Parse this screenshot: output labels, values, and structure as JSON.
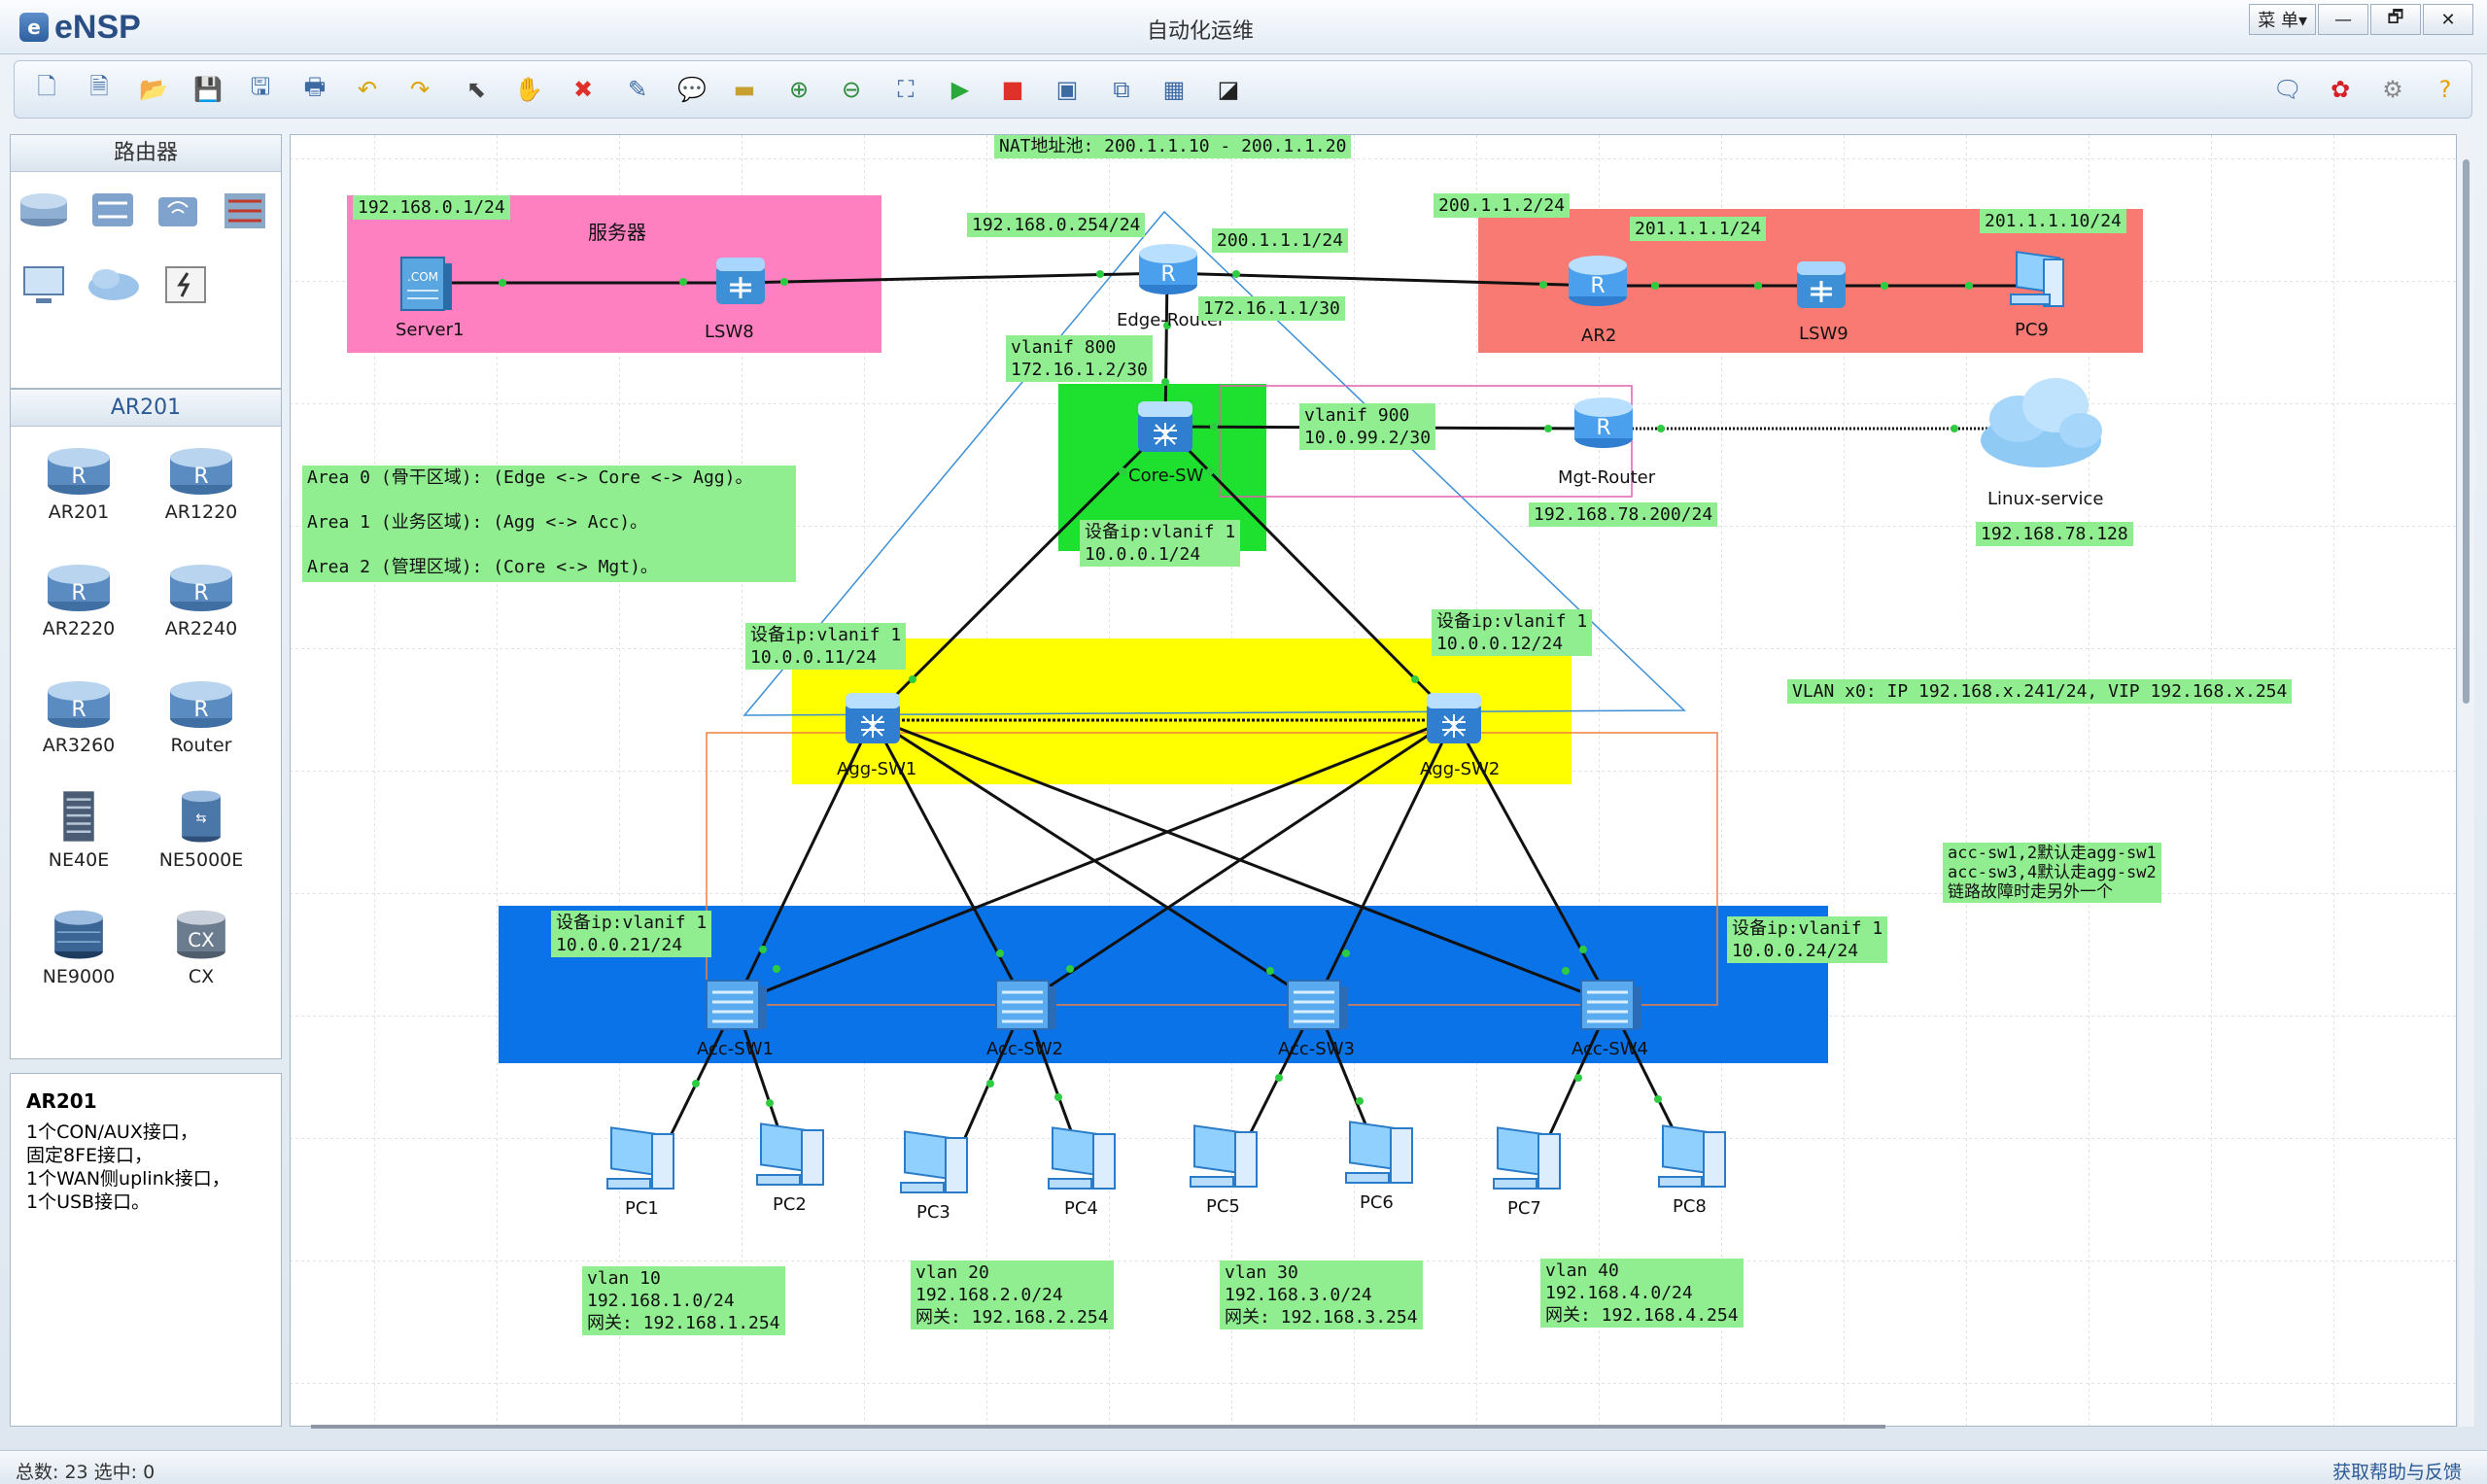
{
  "app": {
    "logo_mark": "e",
    "name": "eNSP",
    "window_title": "自动化运维",
    "menu_label": "菜 单▾",
    "minimize": "—",
    "restore": "🗗",
    "close": "✕"
  },
  "toolbar": {
    "left_icons": [
      "new-topology-icon",
      "new-lab-icon",
      "open-icon",
      "save-icon",
      "save-as-icon",
      "print-icon",
      "undo-icon",
      "redo-icon",
      "select-icon",
      "pan-hand-icon",
      "delete-icon",
      "delete-all-links-icon",
      "text-note-icon",
      "rectangle-icon",
      "zoom-in-icon",
      "zoom-out-icon",
      "fit-icon",
      "start-device-icon",
      "stop-device-icon",
      "capture-icon",
      "topology-icon",
      "grid-icon",
      "terminal-icon"
    ],
    "right_icons": [
      "chat-icon",
      "huawei-icon",
      "settings-icon",
      "help-icon"
    ]
  },
  "device_panel": {
    "title": "路由器",
    "category_icons": [
      "router-category-icon",
      "switch-category-icon",
      "wireless-category-icon",
      "firewall-category-icon",
      "pc-category-icon",
      "cloud-category-icon",
      "power-category-icon"
    ],
    "sub_title": "AR201",
    "models": [
      "AR201",
      "AR1220",
      "AR2220",
      "AR2240",
      "AR3260",
      "Router",
      "NE40E",
      "NE5000E",
      "NE9000",
      "CX"
    ]
  },
  "info_panel": {
    "title": "AR201",
    "lines": [
      "1个CON/AUX接口，",
      "固定8FE接口，",
      "1个WAN侧uplink接口，",
      "1个USB接口。"
    ]
  },
  "topology": {
    "devices": {
      "server1": "Server1",
      "lsw8": "LSW8",
      "edge": "Edge-Router",
      "ar2": "AR2",
      "lsw9": "LSW9",
      "pc9": "PC9",
      "core": "Core-SW",
      "mgt": "Mgt-Router",
      "linux": "Linux-service",
      "agg1": "Agg-SW1",
      "agg2": "Agg-SW2",
      "acc1": "Acc-SW1",
      "acc2": "Acc-SW2",
      "acc3": "Acc-SW3",
      "acc4": "Acc-SW4",
      "pc1": "PC1",
      "pc2": "PC2",
      "pc3": "PC3",
      "pc4": "PC4",
      "pc5": "PC5",
      "pc6": "PC6",
      "pc7": "PC7",
      "pc8": "PC8"
    },
    "labels": {
      "nat_pool": "NAT地址池: 200.1.1.10 - 200.1.1.20",
      "server_net": "192.168.0.1/24",
      "server_area": "服务器",
      "edge_lan": "192.168.0.254/24",
      "edge_wan": "200.1.1.1/24",
      "ar2_wan": "200.1.1.2/24",
      "ar2_lan": "201.1.1.1/24",
      "pc9_ip": "201.1.1.10/24",
      "edge_core": "172.16.1.1/30",
      "core_vlanif800": "vlanif 800\n172.16.1.2/30",
      "core_vlanif900": "vlanif 900\n10.0.99.2/30",
      "mgt_ip": "192.168.78.200/24",
      "linux_ip": "192.168.78.128",
      "core_mgmt": "设备ip:vlanif 1\n10.0.0.1/24",
      "areas": "Area 0 (骨干区域): (Edge <-> Core <-> Agg)。\n\nArea 1 (业务区域): (Agg <-> Acc)。\n\nArea 2 (管理区域): (Core <-> Mgt)。",
      "agg1_mgmt": "设备ip:vlanif 1\n10.0.0.11/24",
      "agg2_mgmt": "设备ip:vlanif 1\n10.0.0.12/24",
      "vlan_vip": "VLAN x0: IP 192.168.x.241/24, VIP 192.168.x.254",
      "uplink_note": "acc-sw1,2默认走agg-sw1\nacc-sw3,4默认走agg-sw2\n链路故障时走另外一个",
      "acc1_mgmt": "设备ip:vlanif 1\n10.0.0.21/24",
      "acc4_mgmt": "设备ip:vlanif 1\n10.0.0.24/24",
      "vlan10": "vlan 10\n192.168.1.0/24\n网关: 192.168.1.254",
      "vlan20": "vlan 20\n192.168.2.0/24\n网关: 192.168.2.254",
      "vlan30": "vlan 30\n192.168.3.0/24\n网关: 192.168.3.254",
      "vlan40": "vlan 40\n192.168.4.0/24\n网关: 192.168.4.254"
    },
    "colors": {
      "server_area": "#ff80c0",
      "internet_area": "#f87a72",
      "core_area": "#1ee02f",
      "agg_area": "#ffff00",
      "acc_area": "#0a73e8",
      "label_bg": "#90ee90"
    }
  },
  "status": {
    "summary": "总数: 23  选中: 0",
    "help_link": "获取帮助与反馈"
  }
}
